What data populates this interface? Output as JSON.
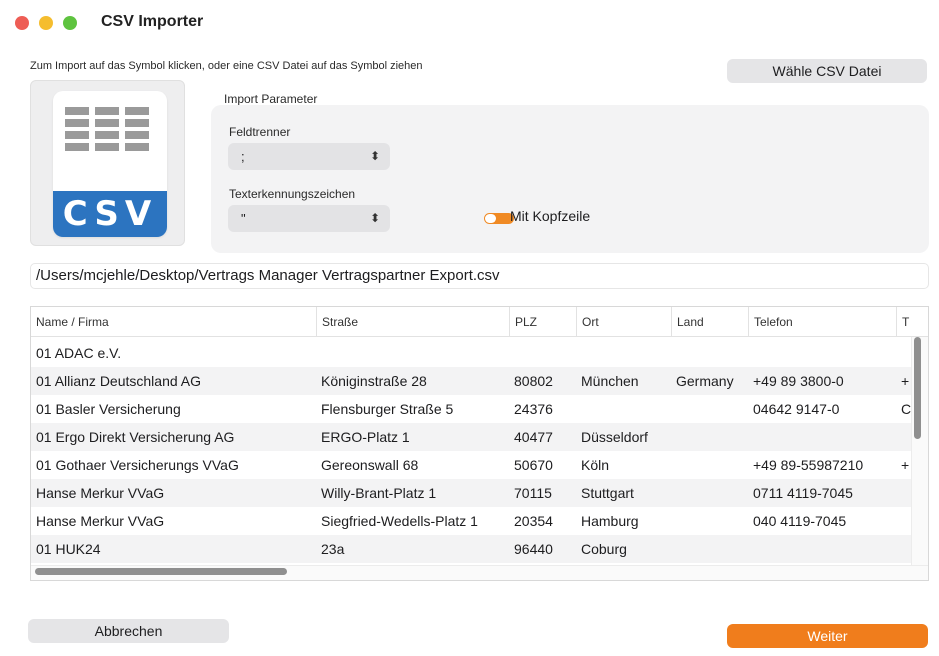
{
  "window": {
    "title": "CSV Importer",
    "controls": [
      "close",
      "minimize",
      "zoom"
    ]
  },
  "hint": "Zum Import auf das Symbol klicken, oder eine CSV Datei auf das Symbol ziehen",
  "choose_button": "Wähle CSV Datei",
  "csv_icon": {
    "name": "csv-file-icon",
    "label": "CSV",
    "band_color": "#2c74c0"
  },
  "params": {
    "title": "Import Parameter",
    "field_separator": {
      "label": "Feldtrenner",
      "value": ";"
    },
    "text_qualifier": {
      "label": "Texterkennungszeichen",
      "value": "\""
    },
    "header_toggle": {
      "label": "Mit Kopfzeile",
      "on": true
    }
  },
  "file_path": "/Users/mcjehle/Desktop/Vertrags Manager Vertragspartner Export.csv",
  "table": {
    "columns": [
      "Name / Firma",
      "Straße",
      "PLZ",
      "Ort",
      "Land",
      "Telefon",
      "T"
    ],
    "rows": [
      [
        "01 ADAC e.V.",
        "",
        "",
        "",
        "",
        "",
        ""
      ],
      [
        "01 Allianz Deutschland AG",
        "Königinstraße 28",
        "80802",
        "München",
        "Germany",
        "+49 89 3800-0",
        "+"
      ],
      [
        "01 Basler Versicherung",
        "Flensburger Straße 5",
        "24376",
        "",
        "",
        "04642 9147-0",
        "C"
      ],
      [
        "01 Ergo Direkt Versicherung AG",
        "ERGO-Platz 1",
        "40477",
        "Düsseldorf",
        "",
        "",
        ""
      ],
      [
        "01 Gothaer Versicherungs VVaG",
        "Gereonswall 68",
        "50670",
        "Köln",
        "",
        "+49 89-55987210",
        "+"
      ],
      [
        "Hanse Merkur VVaG",
        "Willy-Brant-Platz 1",
        "70115",
        "Stuttgart",
        "",
        "0711 4119-7045",
        ""
      ],
      [
        "Hanse Merkur VVaG",
        "Siegfried-Wedells-Platz 1",
        "20354",
        "Hamburg",
        "",
        "040 4119-7045",
        ""
      ],
      [
        "01 HUK24",
        "23a",
        "96440",
        "Coburg",
        "",
        "",
        ""
      ]
    ]
  },
  "cancel_button": "Abbrechen",
  "next_button": "Weiter",
  "colors": {
    "accent": "#f07d1c",
    "csv_blue": "#2c74c0"
  }
}
